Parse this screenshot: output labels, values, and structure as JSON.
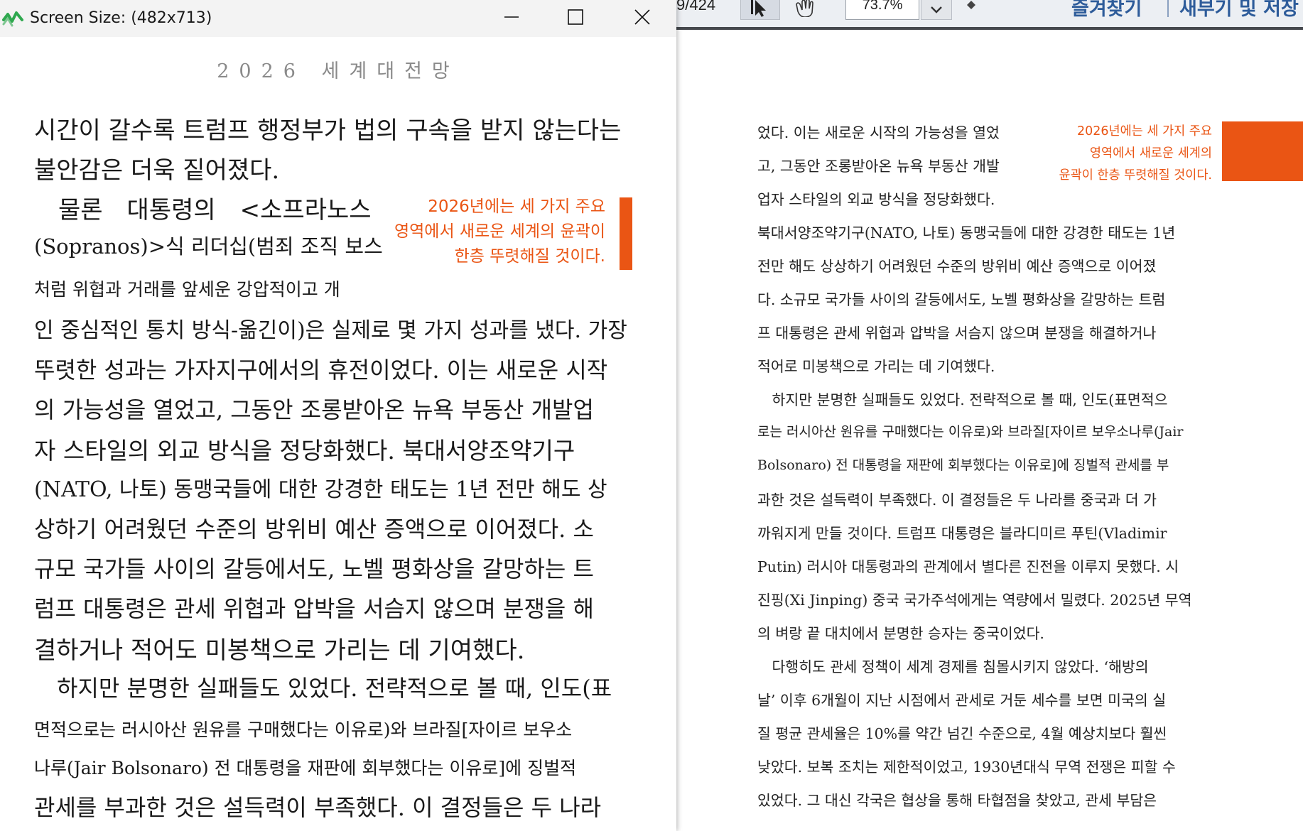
{
  "window": {
    "title": "Screen Size: (482x713)",
    "running_header": "2026 세계대전망",
    "callout": [
      "2026년에는 세 가지 주요",
      "영역에서 새로운 세계의 윤곽이",
      "한층 뚜렷해질 것이다."
    ],
    "lines": [
      "시간이 갈수록 트럼프 행정부가 법의 구속을 받지 않는다는",
      "불안감은 더욱 짙어졌다.",
      "　물론　대통령의　<소프라노스",
      "(Sopranos)>식 리더십(범죄 조직 보스",
      "처럼 위협과 거래를 앞세운 강압적이고 개",
      "인 중심적인 통치 방식-옮긴이)은 실제로 몇 가지 성과를 냈다. 가장",
      "뚜렷한 성과는 가자지구에서의 휴전이었다. 이는 새로운 시작",
      "의 가능성을 열었고, 그동안 조롱받아온 뉴욕 부동산 개발업",
      "자 스타일의 외교 방식을 정당화했다. 북대서양조약기구",
      "(NATO, 나토) 동맹국들에 대한 강경한 태도는 1년 전만 해도 상",
      "상하기 어려웠던 수준의 방위비 예산 증액으로 이어졌다. 소",
      "규모 국가들 사이의 갈등에서도, 노벨 평화상을 갈망하는 트",
      "럼프 대통령은 관세 위협과 압박을 서슴지 않으며 분쟁을 해",
      "결하거나 적어도 미봉책으로 가리는 데 기여했다.",
      "　하지만 분명한 실패들도 있었다. 전략적으로 볼 때, 인도(표",
      "면적으로는 러시아산 원유를 구매했다는 이유로)와 브라질[자이르 보우소",
      "나루(Jair Bolsonaro) 전 대통령을 재판에 회부했다는 이유로]에 징벌적",
      "관세를 부과한 것은 설득력이 부족했다. 이 결정들은 두 나라"
    ]
  },
  "viewer": {
    "page_counter": "9/424",
    "zoom": "73.7%",
    "links": {
      "bookmarks": "즐겨찾기",
      "new": "새부기 및 저장"
    },
    "pull_quote": [
      "2026년에는 세 가지 주요",
      "영역에서 새로운 세계의",
      "윤곽이 한층 뚜렷해질 것이다."
    ],
    "lines": [
      "었다. 이는 새로운 시작의 가능성을 열었",
      "고, 그동안 조롱받아온 뉴욕 부동산 개발",
      "업자 스타일의 외교 방식을 정당화했다.",
      "북대서양조약기구(NATO, 나토) 동맹국들에 대한 강경한 태도는 1년",
      "전만 해도 상상하기 어려웠던 수준의 방위비 예산 증액으로 이어졌",
      "다. 소규모 국가들 사이의 갈등에서도, 노벨 평화상을 갈망하는 트럼",
      "프 대통령은 관세 위협과 압박을 서슴지 않으며 분쟁을 해결하거나",
      "적어로 미봉책으로 가리는 데 기여했다.",
      "　하지만 분명한 실패들도 있었다. 전략적으로 볼 때, 인도(표면적으",
      "로는 러시아산 원유를 구매했다는 이유로)와 브라질[자이르 보우소나루(Jair",
      "Bolsonaro) 전 대통령을 재판에 회부했다는 이유로]에 징벌적 관세를 부",
      "과한 것은 설득력이 부족했다. 이 결정들은 두 나라를 중국과 더 가",
      "까워지게 만들 것이다. 트럼프 대통령은 블라디미르 푸틴(Vladimir",
      "Putin) 러시아 대통령과의 관계에서 별다른 진전을 이루지 못했다. 시",
      "진핑(Xi Jinping) 중국 국가주석에게는 역량에서 밀렸다. 2025년 무역",
      "의 벼랑 끝 대치에서 분명한 승자는 중국이었다.",
      "　다행히도 관세 정책이 세계 경제를 침몰시키지 않았다. ‘해방의",
      "날’ 이후 6개월이 지난 시점에서 관세로 거둔 세수를 보면 미국의 실",
      "질 평균 관세율은 10%를 약간 넘긴 수준으로, 4월 예상치보다 훨씬",
      "낮았다. 보복 조치는 제한적이었고, 1930년대식 무역 전쟁은 피할 수",
      "있었다. 그 대신 각국은 협상을 통해 타협점을 찾았고, 관세 부담은"
    ]
  },
  "colors": {
    "accent": "#ea5514",
    "link": "#2e5c9a",
    "titlebar": "#f3f3f3"
  }
}
